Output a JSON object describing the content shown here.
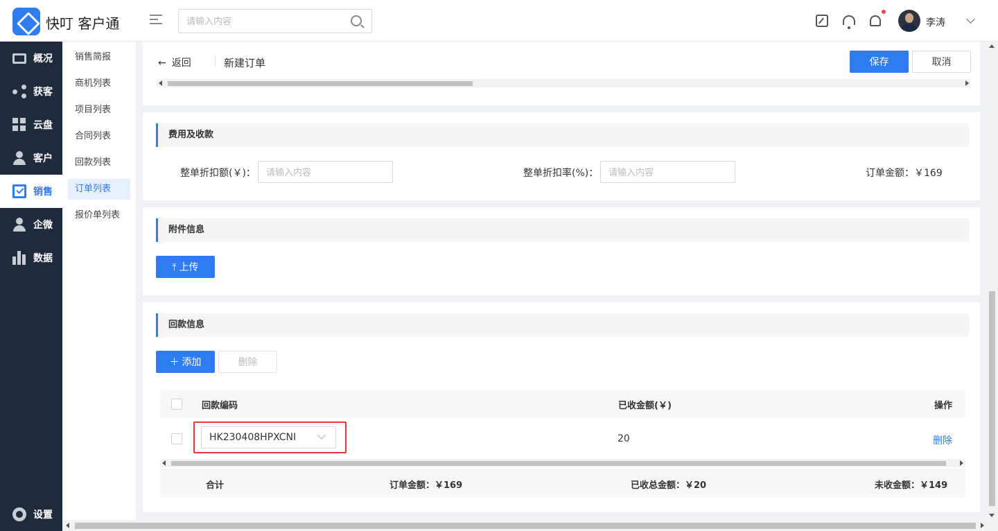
{
  "app": {
    "title": "快叮 客户通"
  },
  "search": {
    "placeholder": "请输入内容"
  },
  "user": {
    "name": "李涛",
    "has_notification": true
  },
  "nav": {
    "items": [
      {
        "label": "概况",
        "icon": "monitor-icon"
      },
      {
        "label": "获客",
        "icon": "share-icon"
      },
      {
        "label": "云盘",
        "icon": "grid-icon"
      },
      {
        "label": "客户",
        "icon": "person-icon"
      },
      {
        "label": "销售",
        "icon": "clipboard-check-icon",
        "active": true
      },
      {
        "label": "企微",
        "icon": "contact-icon"
      },
      {
        "label": "数据",
        "icon": "bar-chart-icon"
      }
    ],
    "settings_label": "设置"
  },
  "subnav": {
    "items": [
      {
        "label": "销售简报"
      },
      {
        "label": "商机列表"
      },
      {
        "label": "项目列表"
      },
      {
        "label": "合同列表"
      },
      {
        "label": "回款列表"
      },
      {
        "label": "订单列表",
        "active": true
      },
      {
        "label": "报价单列表"
      }
    ]
  },
  "header": {
    "back_label": "返回",
    "title": "新建订单",
    "save_label": "保存",
    "cancel_label": "取消"
  },
  "fees": {
    "section_title": "费用及收款",
    "discount_amount_label": "整单折扣额(￥)：",
    "discount_amount_placeholder": "请输入内容",
    "discount_rate_label": "整单折扣率(%)：",
    "discount_rate_placeholder": "请输入内容",
    "order_amount_text": "订单金额：￥169"
  },
  "attachments": {
    "section_title": "附件信息",
    "upload_label": "上传"
  },
  "payments": {
    "section_title": "回款信息",
    "add_label": "添加",
    "delete_label": "删除",
    "columns": {
      "code": "回款编码",
      "received": "已收金额(￥)",
      "action": "操作"
    },
    "rows": [
      {
        "code": "HK230408HPXCNI",
        "received": "20",
        "action": "删除"
      }
    ],
    "summary": {
      "label": "合计",
      "order_amount": "订单金额：￥169",
      "received_total": "已收总金额：￥20",
      "unreceived": "未收金额：￥149"
    }
  },
  "colors": {
    "accent": "#2f7bf0",
    "nav_bg": "#1f2a3d",
    "highlight": "#e53935"
  }
}
